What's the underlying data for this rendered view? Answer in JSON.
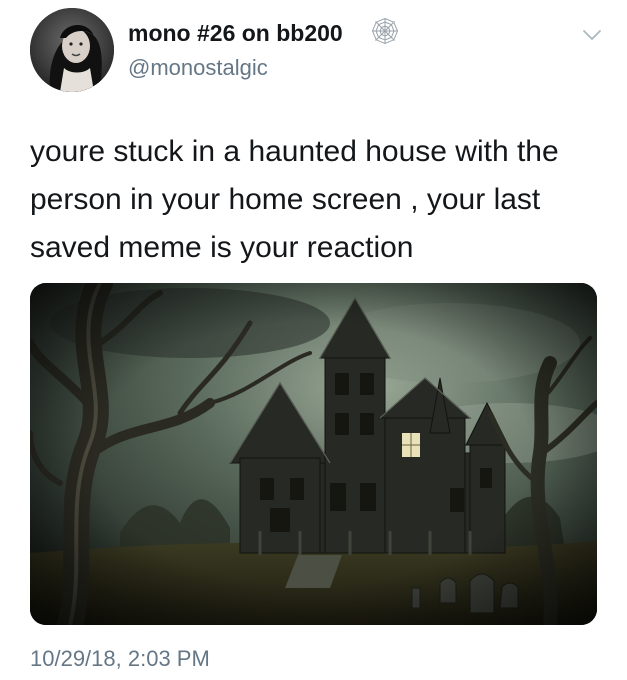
{
  "tweet": {
    "display_name": "mono #26 on bb200",
    "handle": "@monostalgic",
    "text_lines": [
      "youre stuck in a haunted house with the",
      "person in your home screen , your last",
      "saved meme is your reaction"
    ],
    "timestamp": "10/29/18, 2:03 PM"
  },
  "icons": {
    "name_badge": "spiderweb-icon",
    "menu": "chevron-down-icon"
  },
  "colors": {
    "text_primary": "#14171a",
    "text_secondary": "#657786",
    "background": "#ffffff"
  }
}
